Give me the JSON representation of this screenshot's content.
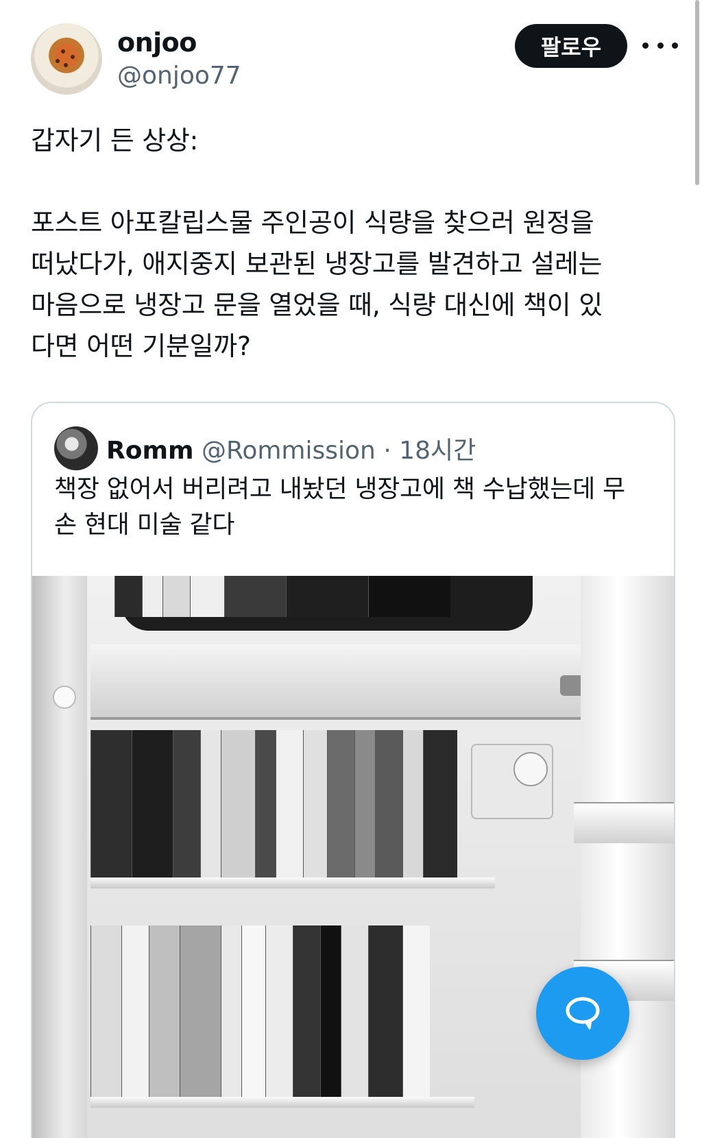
{
  "author": {
    "display_name": "onjoo",
    "handle": "@onjoo77"
  },
  "actions": {
    "follow_label": "팔로우"
  },
  "tweet": {
    "text": "갑자기 든 상상:\n\n포스트 아포칼립스물 주인공이 식량을 찾으러 원정을\n떠났다가, 애지중지 보관된 냉장고를 발견하고 설레는\n마음으로 냉장고 문을 열었을 때, 식량 대신에 책이 있\n다면 어떤 기분일까?"
  },
  "quoted_tweet": {
    "display_name": "Romm",
    "handle": "@Rommission",
    "separator": "·",
    "time": "18시간",
    "text": "책장 없어서 버리려고 내놨던 냉장고에 책 수납했는데 무\n손 현대 미술 같다"
  },
  "colors": {
    "accent": "#1d9bf0",
    "text_primary": "#0f1419",
    "text_secondary": "#536471",
    "border": "#cfd9de"
  },
  "icons": {
    "more": "more-horizontal-icon",
    "compose": "chat-bubble-icon"
  }
}
